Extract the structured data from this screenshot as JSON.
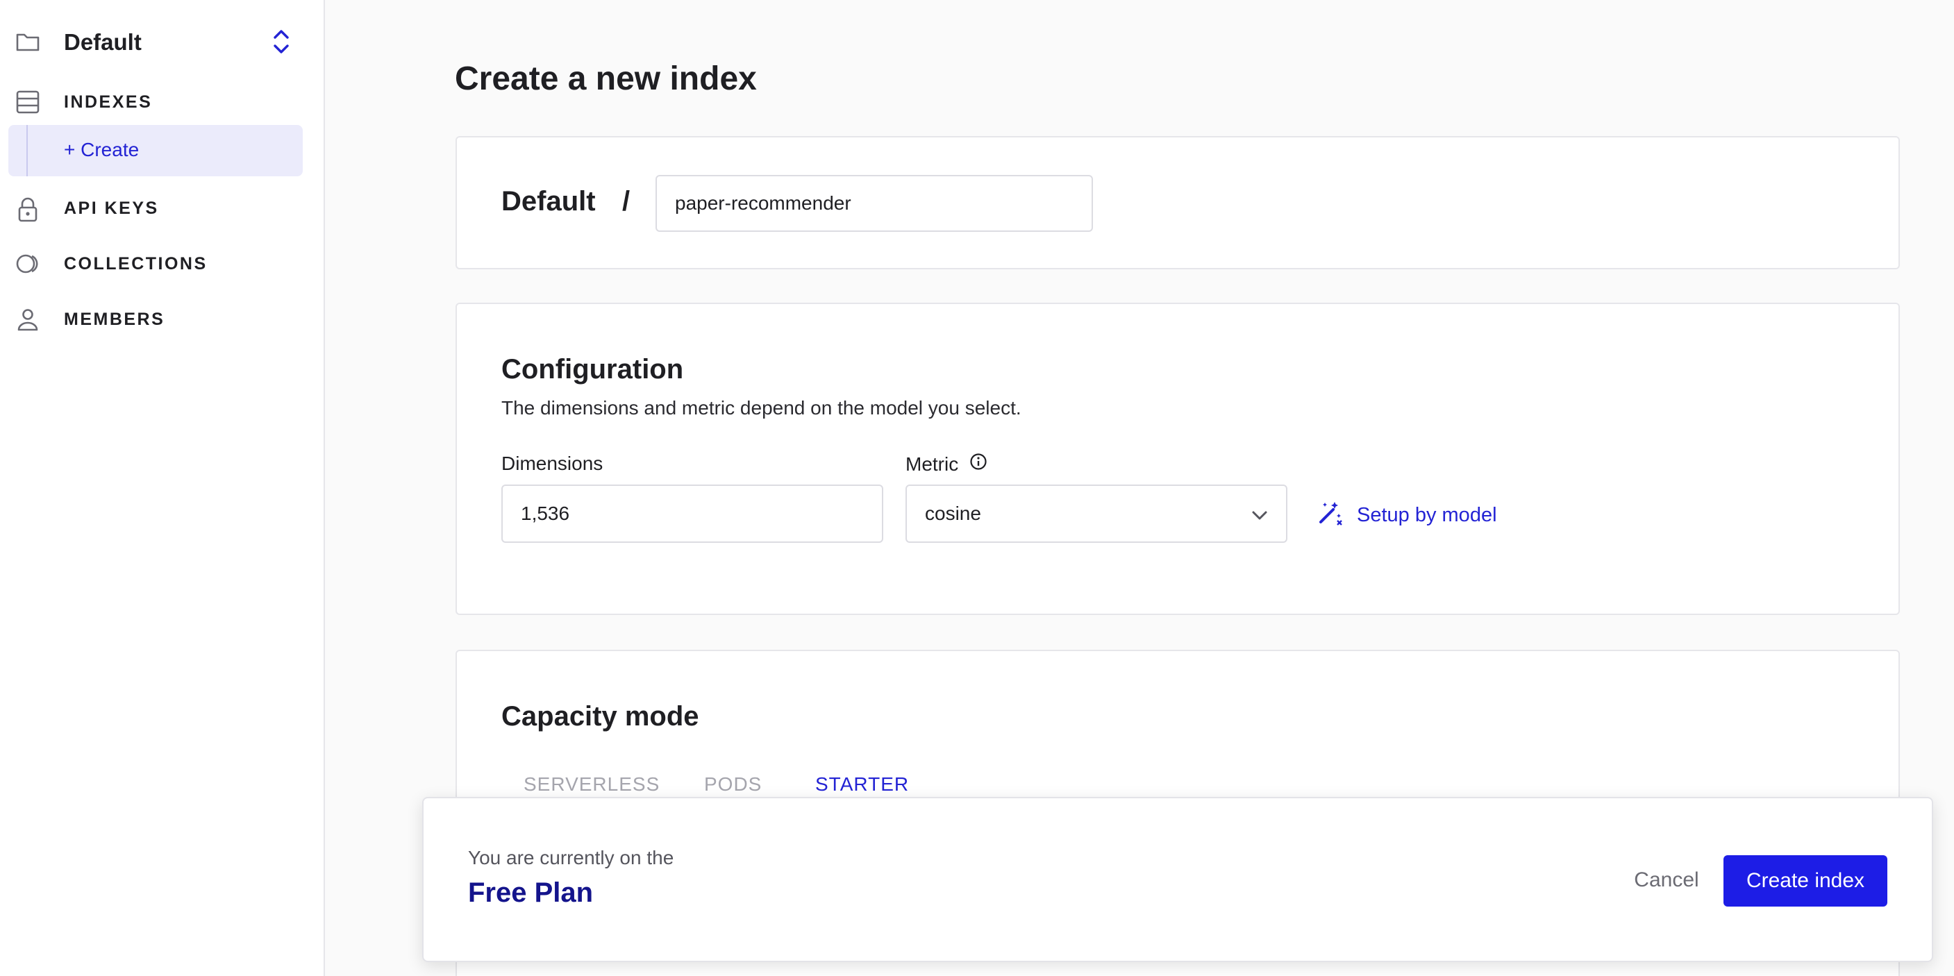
{
  "sidebar": {
    "project_name": "Default",
    "items": [
      {
        "label": "INDEXES"
      },
      {
        "label": "+ Create"
      },
      {
        "label": "API KEYS"
      },
      {
        "label": "COLLECTIONS"
      },
      {
        "label": "MEMBERS"
      }
    ]
  },
  "page": {
    "title": "Create a new index"
  },
  "name_card": {
    "project": "Default",
    "separator": "/",
    "index_name": "paper-recommender"
  },
  "configuration": {
    "title": "Configuration",
    "description": "The dimensions and metric depend on the model you select.",
    "dimensions_label": "Dimensions",
    "dimensions_value": "1,536",
    "metric_label": "Metric",
    "metric_value": "cosine",
    "setup_link": "Setup by model"
  },
  "capacity": {
    "title": "Capacity mode",
    "tabs": [
      {
        "label": "SERVERLESS",
        "active": false
      },
      {
        "label": "PODS",
        "active": false
      },
      {
        "label": "STARTER",
        "active": true
      }
    ]
  },
  "footer": {
    "plan_caption": "You are currently on the",
    "plan_name": "Free Plan",
    "cancel_label": "Cancel",
    "create_label": "Create index"
  },
  "colors": {
    "accent": "#1d1de6",
    "link": "#2323d4",
    "plan": "#14148c",
    "active_nav_bg": "#ebebfb"
  }
}
